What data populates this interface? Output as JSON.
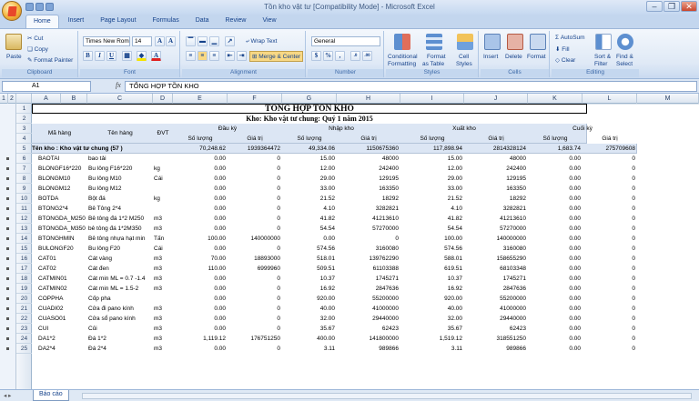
{
  "window": {
    "title": "Tồn kho vật tư [Compatibility Mode] - Microsoft Excel"
  },
  "ribbon_tabs": [
    "Home",
    "Insert",
    "Page Layout",
    "Formulas",
    "Data",
    "Review",
    "View"
  ],
  "ribbon": {
    "clipboard": {
      "label": "Clipboard",
      "paste": "Paste",
      "cut": "Cut",
      "copy": "Copy",
      "format_painter": "Format Painter"
    },
    "font": {
      "label": "Font",
      "name": "Times New Rom",
      "size": "14",
      "bold": "B",
      "italic": "I",
      "underline": "U"
    },
    "alignment": {
      "label": "Alignment",
      "wrap_text": "Wrap Text",
      "merge_center": "Merge & Center"
    },
    "number": {
      "label": "Number",
      "format": "General",
      "currency": "$",
      "percent": "%",
      "comma": ",",
      "inc_dec": ".0",
      "dec_dec": ".00"
    },
    "styles": {
      "label": "Styles",
      "conditional": "Conditional",
      "conditional2": "Formatting",
      "format_table": "Format",
      "format_table2": "as Table",
      "cell_styles": "Cell",
      "cell_styles2": "Styles"
    },
    "cells": {
      "label": "Cells",
      "insert": "Insert",
      "delete": "Delete",
      "format": "Format"
    },
    "editing": {
      "label": "Editing",
      "autosum": "AutoSum",
      "fill": "Fill",
      "clear": "Clear",
      "sort": "Sort &",
      "sort2": "Filter",
      "find": "Find &",
      "find2": "Select"
    }
  },
  "formula_bar": {
    "cell": "A1",
    "fx": "fx",
    "value": "TỔNG HỢP TỒN KHO"
  },
  "columns": [
    "A",
    "B",
    "C",
    "D",
    "E",
    "F",
    "G",
    "H",
    "I",
    "J",
    "K",
    "L",
    "M"
  ],
  "outline_levels": [
    "1",
    "2"
  ],
  "sheet": {
    "title": "TỔNG HỢP TỒN KHO",
    "subtitle": "Kho: Kho vật tư chung: Quý 1 năm 2015",
    "headers": {
      "ma_hang": "Mã hàng",
      "ten_hang": "Tên hàng",
      "dvt": "ĐVT",
      "dau_ky": "Đầu kỳ",
      "nhap_kho": "Nhập kho",
      "xuat_kho": "Xuất kho",
      "cuoi_ky": "Cuối kỳ",
      "so_luong": "Số lượng",
      "gia_tri": "Giá trị"
    },
    "group_row": {
      "label": "Tên kho : Kho vật tư chung (57 )",
      "values": [
        "70,248.62",
        "1939364472",
        "49,334.06",
        "1150675360",
        "117,898.94",
        "2814328124",
        "1,683.74",
        "275709608"
      ]
    },
    "rows": [
      {
        "n": "6",
        "ma": "BAOTAI",
        "ten": "bao tải",
        "dvt": "",
        "v": [
          "0.00",
          "0",
          "15.00",
          "48000",
          "15.00",
          "48000",
          "0.00",
          "0"
        ]
      },
      {
        "n": "7",
        "ma": "BLONGF16*220",
        "ten": "Bu lông F16*220",
        "dvt": "kg",
        "v": [
          "0.00",
          "0",
          "12.00",
          "242400",
          "12.00",
          "242400",
          "0.00",
          "0"
        ]
      },
      {
        "n": "8",
        "ma": "BLONGM10",
        "ten": "Bu lông M10",
        "dvt": "Cái",
        "v": [
          "0.00",
          "0",
          "29.00",
          "129195",
          "29.00",
          "129195",
          "0.00",
          "0"
        ]
      },
      {
        "n": "9",
        "ma": "BLONGM12",
        "ten": "Bu lông M12",
        "dvt": "",
        "v": [
          "0.00",
          "0",
          "33.00",
          "163350",
          "33.00",
          "163350",
          "0.00",
          "0"
        ]
      },
      {
        "n": "10",
        "ma": "BOTDA",
        "ten": "Bột đá",
        "dvt": "kg",
        "v": [
          "0.00",
          "0",
          "21.52",
          "18292",
          "21.52",
          "18292",
          "0.00",
          "0"
        ]
      },
      {
        "n": "11",
        "ma": "BTONG2*4",
        "ten": "Bê Tông 2*4",
        "dvt": "",
        "v": [
          "0.00",
          "0",
          "4.10",
          "3282821",
          "4.10",
          "3282821",
          "0.00",
          "0"
        ]
      },
      {
        "n": "12",
        "ma": "BTONGDA_M250",
        "ten": "Bê tông đá 1*2 M250",
        "dvt": "m3",
        "v": [
          "0.00",
          "0",
          "41.82",
          "41213610",
          "41.82",
          "41213610",
          "0.00",
          "0"
        ]
      },
      {
        "n": "13",
        "ma": "BTONGDA_M350",
        "ten": "bê tông đá 1*2M350",
        "dvt": "m3",
        "v": [
          "0.00",
          "0",
          "54.54",
          "57270000",
          "54.54",
          "57270000",
          "0.00",
          "0"
        ]
      },
      {
        "n": "14",
        "ma": "BTONGHMIN",
        "ten": "Bê tông nhựa hạt min",
        "dvt": "Tấn",
        "v": [
          "100.00",
          "140000000",
          "0.00",
          "0",
          "100.00",
          "140000000",
          "0.00",
          "0"
        ]
      },
      {
        "n": "15",
        "ma": "BULONGF20",
        "ten": "Bu lông F20",
        "dvt": "Cái",
        "v": [
          "0.00",
          "0",
          "574.56",
          "3160080",
          "574.56",
          "3160080",
          "0.00",
          "0"
        ]
      },
      {
        "n": "16",
        "ma": "CAT01",
        "ten": "Cát vàng",
        "dvt": "m3",
        "v": [
          "70.00",
          "18893000",
          "518.01",
          "139762290",
          "588.01",
          "158655290",
          "0.00",
          "0"
        ]
      },
      {
        "n": "17",
        "ma": "CAT02",
        "ten": "Cát đen",
        "dvt": "m3",
        "v": [
          "110.00",
          "6999960",
          "509.51",
          "61103388",
          "619.51",
          "68103348",
          "0.00",
          "0"
        ]
      },
      {
        "n": "18",
        "ma": "CATMIN01",
        "ten": "Cát min ML = 0.7 -1.4",
        "dvt": "m3",
        "v": [
          "0.00",
          "0",
          "10.37",
          "1745271",
          "10.37",
          "1745271",
          "0.00",
          "0"
        ]
      },
      {
        "n": "19",
        "ma": "CATMIN02",
        "ten": "Cát min ML = 1.5-2",
        "dvt": "m3",
        "v": [
          "0.00",
          "0",
          "16.92",
          "2847636",
          "16.92",
          "2847636",
          "0.00",
          "0"
        ]
      },
      {
        "n": "20",
        "ma": "COPPHA",
        "ten": "Cốp pha",
        "dvt": "",
        "v": [
          "0.00",
          "0",
          "920.00",
          "55200000",
          "920.00",
          "55200000",
          "0.00",
          "0"
        ]
      },
      {
        "n": "21",
        "ma": "CUADI02",
        "ten": "Cửa đi pano kính",
        "dvt": "m3",
        "v": [
          "0.00",
          "0",
          "40.00",
          "41000000",
          "40.00",
          "41000000",
          "0.00",
          "0"
        ]
      },
      {
        "n": "22",
        "ma": "CUASO01",
        "ten": "Cửa sổ pano kính",
        "dvt": "m3",
        "v": [
          "0.00",
          "0",
          "32.00",
          "29440000",
          "32.00",
          "29440000",
          "0.00",
          "0"
        ]
      },
      {
        "n": "23",
        "ma": "CUI",
        "ten": "Củi",
        "dvt": "m3",
        "v": [
          "0.00",
          "0",
          "35.67",
          "62423",
          "35.67",
          "62423",
          "0.00",
          "0"
        ]
      },
      {
        "n": "24",
        "ma": "DA1*2",
        "ten": "Đá 1*2",
        "dvt": "m3",
        "v": [
          "1,119.12",
          "176751250",
          "400.00",
          "141800000",
          "1,519.12",
          "318551250",
          "0.00",
          "0"
        ]
      },
      {
        "n": "25",
        "ma": "DA2*4",
        "ten": "Đá 2*4",
        "dvt": "m3",
        "v": [
          "0.00",
          "0",
          "3.11",
          "989866",
          "3.11",
          "989866",
          "0.00",
          "0"
        ]
      }
    ]
  },
  "sheet_tab": "Báo cáo"
}
